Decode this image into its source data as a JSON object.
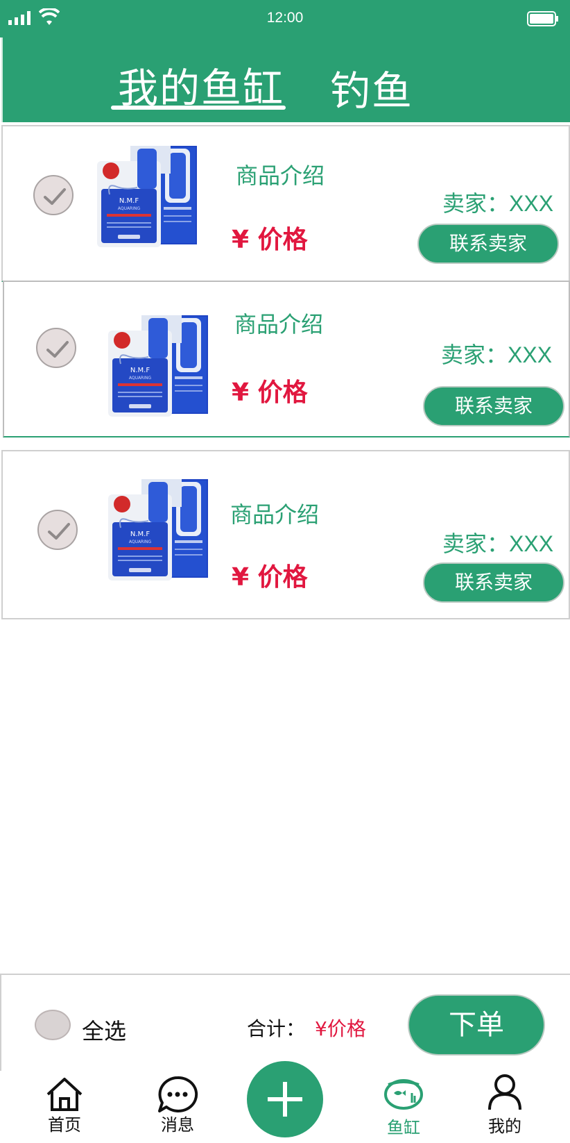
{
  "status_bar": {
    "time": "12:00"
  },
  "header": {
    "tabs": [
      {
        "label": "我的鱼缸",
        "active": true
      },
      {
        "label": "钓鱼",
        "active": false
      }
    ]
  },
  "items": [
    {
      "intro": "商品介绍",
      "price": "¥ 价格",
      "seller": "卖家：XXX",
      "contact": "联系卖家",
      "checked": true
    },
    {
      "intro": "商品介绍",
      "price": "¥ 价格",
      "seller": "卖家：XXX",
      "contact": "联系卖家",
      "checked": true
    },
    {
      "intro": "商品介绍",
      "price": "¥ 价格",
      "seller": "卖家：XXX",
      "contact": "联系卖家",
      "checked": true
    }
  ],
  "product_image": {
    "brand_text": "N.M.F",
    "sub_text": "AQUARING"
  },
  "footer": {
    "select_all": "全选",
    "total_label": "合计：",
    "total_value": "¥价格",
    "order_button": "下单"
  },
  "nav": {
    "home": "首页",
    "messages": "消息",
    "fish_tank": "鱼缸",
    "me": "我的",
    "active": "fish_tank"
  },
  "colors": {
    "brand_green": "#2aa073",
    "price_red": "#e1173f",
    "check_gray": "#e6dede"
  }
}
